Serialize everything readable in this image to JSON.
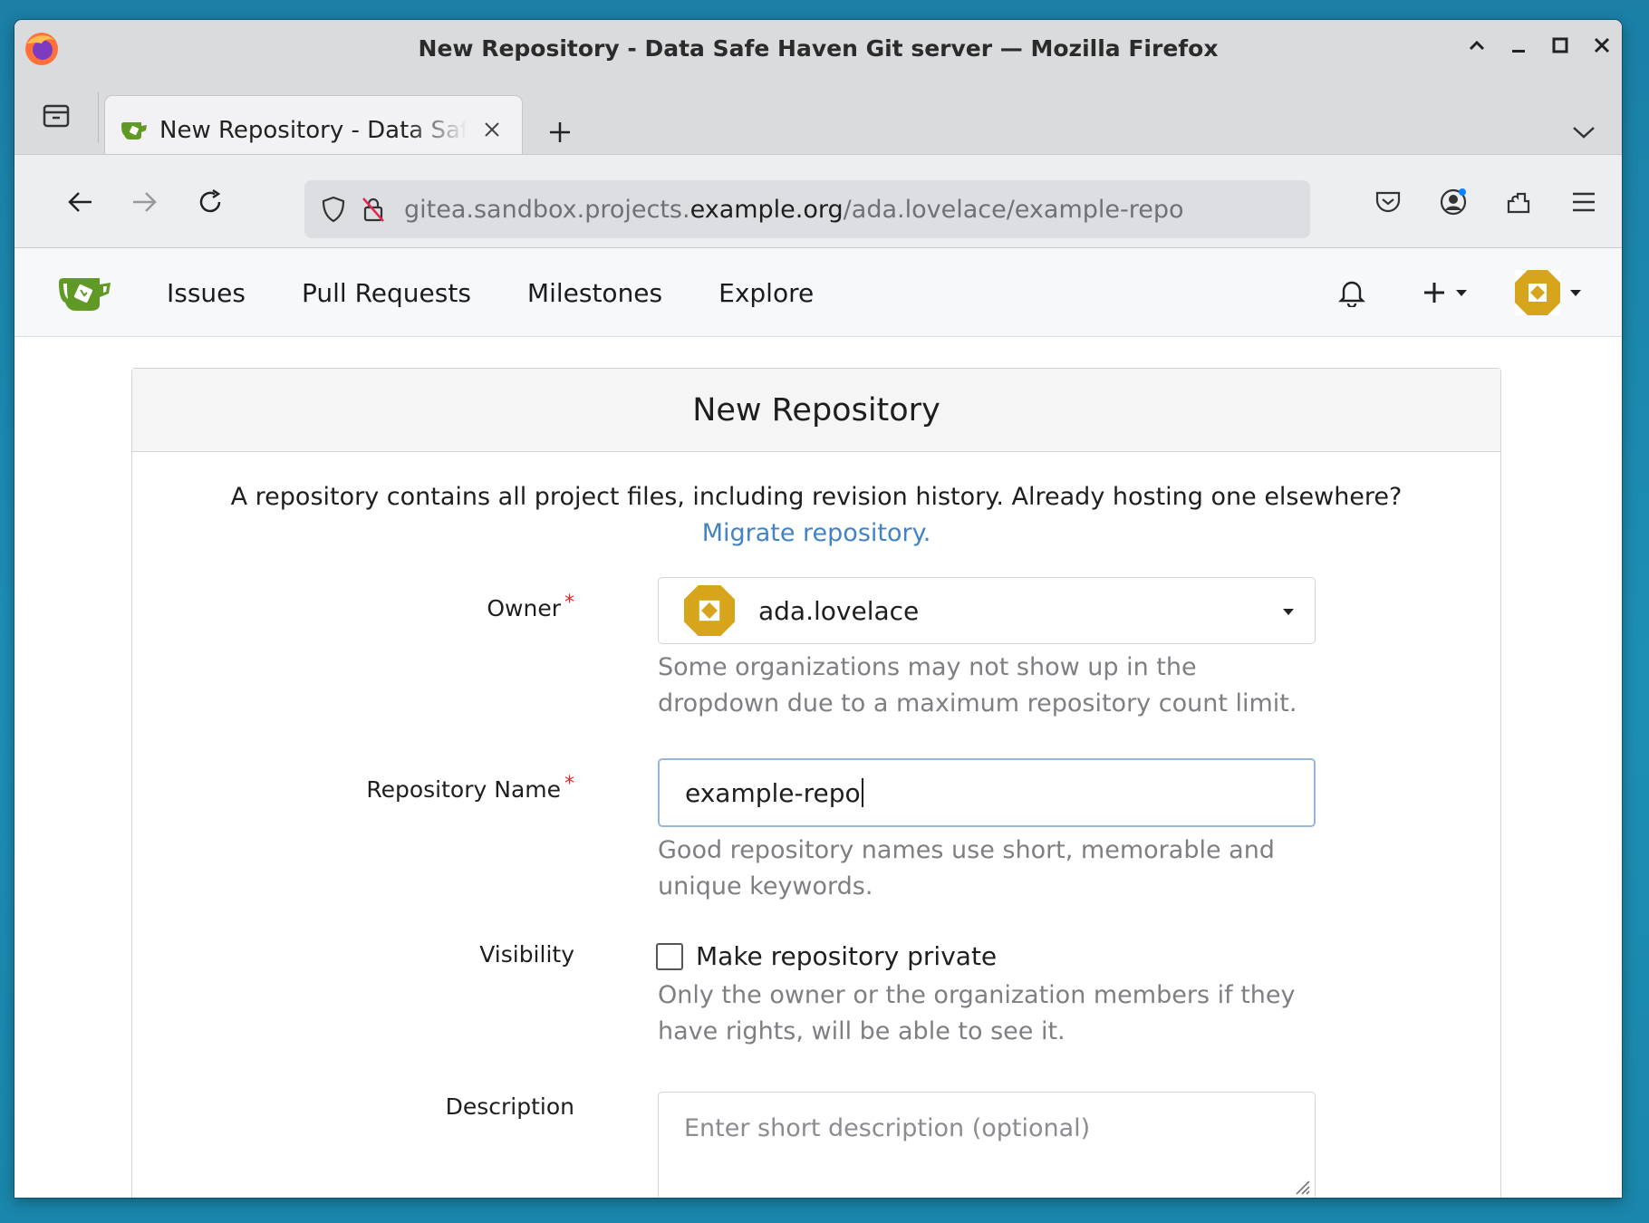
{
  "window": {
    "title": "New Repository - Data Safe Haven Git server — Mozilla Firefox"
  },
  "tab": {
    "label": "New Repository - Data Safe Haven Git server"
  },
  "urlbar": {
    "prefix": "gitea.sandbox.projects.",
    "host": "example.org",
    "path": "/ada.lovelace/example-repo"
  },
  "gitea_nav": {
    "links": [
      "Issues",
      "Pull Requests",
      "Milestones",
      "Explore"
    ]
  },
  "form": {
    "header": "New Repository",
    "intro": "A repository contains all project files, including revision history. Already hosting one elsewhere?",
    "migrate_link": "Migrate repository.",
    "owner": {
      "label": "Owner",
      "required_mark": "*",
      "value": "ada.lovelace",
      "help": "Some organizations may not show up in the dropdown due to a maximum repository count limit."
    },
    "repo_name": {
      "label": "Repository Name",
      "required_mark": "*",
      "value": "example-repo",
      "help": "Good repository names use short, memorable and unique keywords."
    },
    "visibility": {
      "label": "Visibility",
      "checkbox_label": "Make repository private",
      "checked": false,
      "help": "Only the owner or the organization members if they have rights, will be able to see it."
    },
    "description": {
      "label": "Description",
      "placeholder": "Enter short description (optional)"
    }
  },
  "colors": {
    "gitea_green": "#609926",
    "avatar_gold": "#d6a51b",
    "link_blue": "#4183c4",
    "required_red": "#db2828",
    "focus_border": "#96b7dc"
  }
}
